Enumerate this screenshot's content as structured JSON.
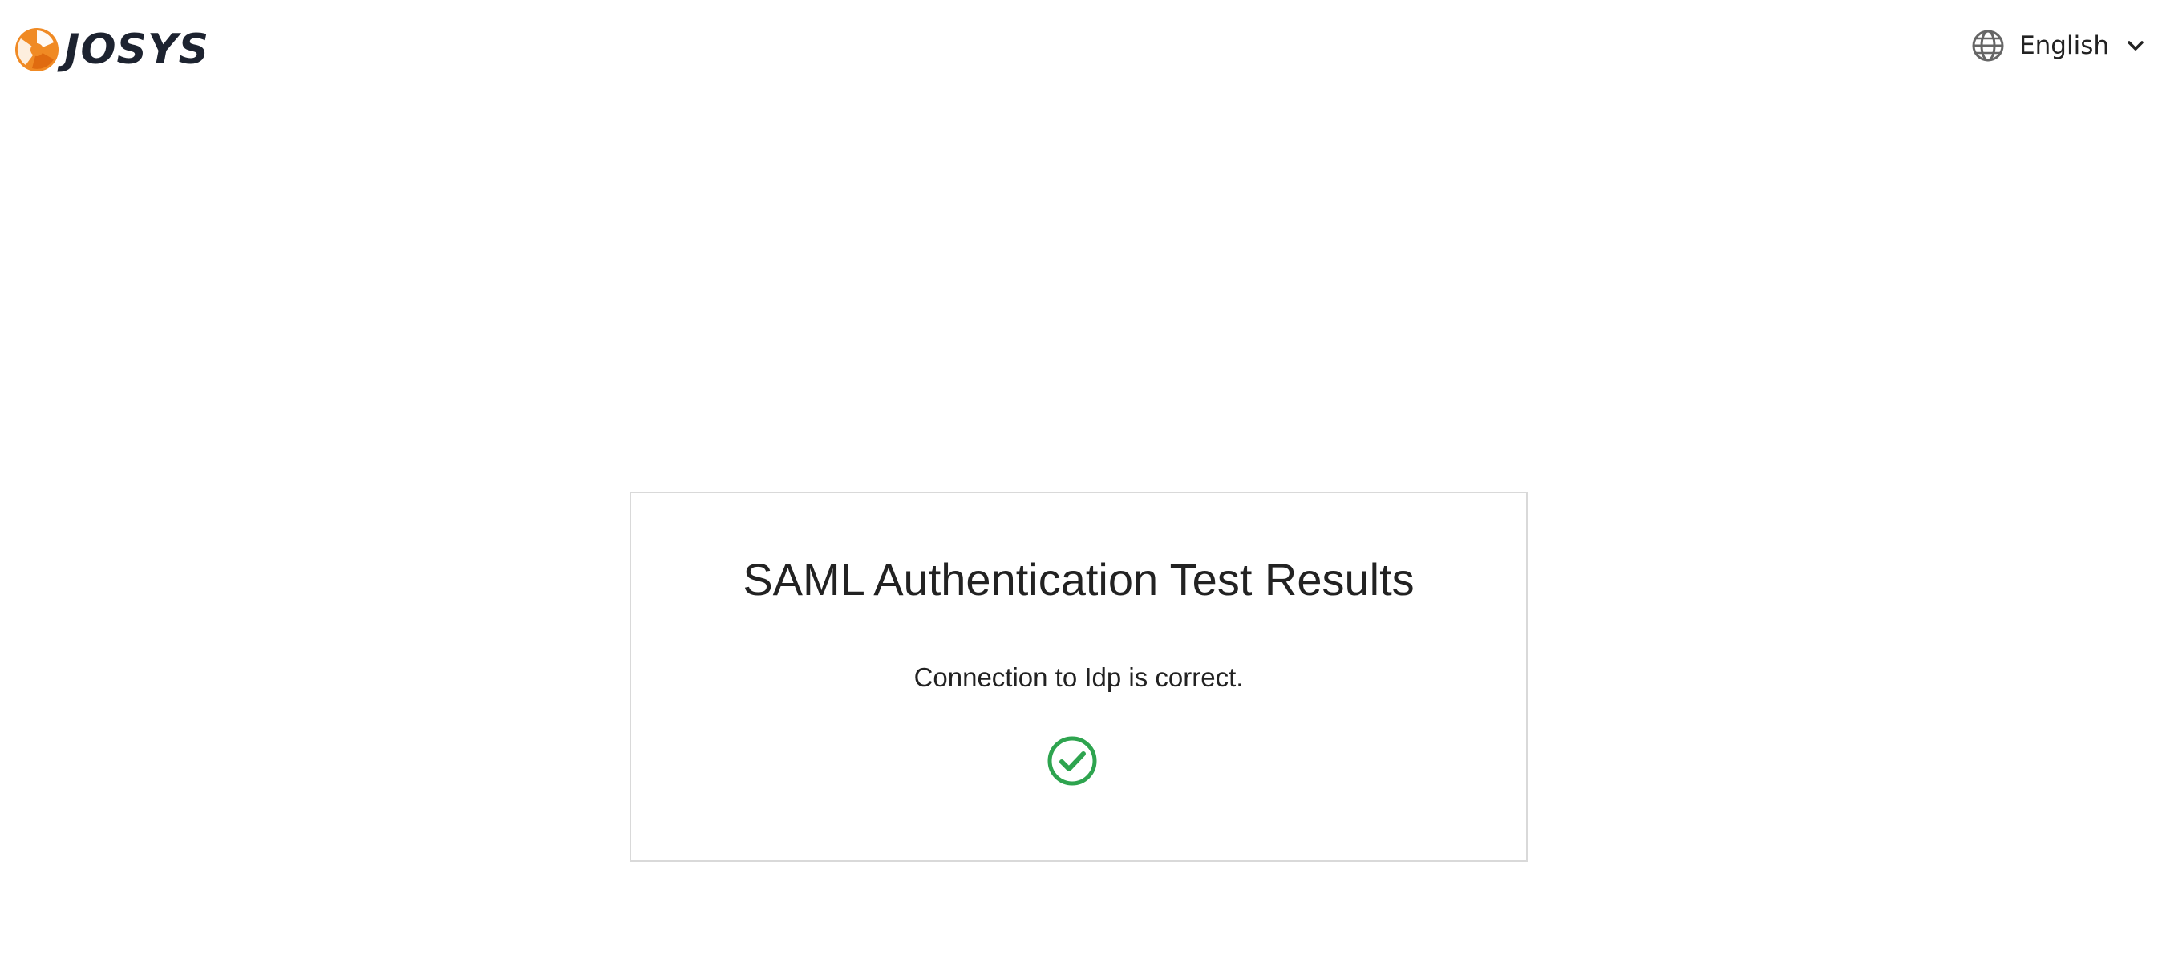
{
  "header": {
    "logo_text": "JOSYS",
    "language": {
      "selected": "English",
      "icon": "globe-icon",
      "dropdown_icon": "chevron-down-icon"
    }
  },
  "result_card": {
    "title": "SAML Authentication Test Results",
    "message": "Connection to Idp is correct.",
    "status_icon": "check-circle-icon"
  },
  "colors": {
    "brand_orange": "#f08a24",
    "success_green": "#2ea44f",
    "text_dark": "#222222",
    "border": "#d9d9d9"
  }
}
